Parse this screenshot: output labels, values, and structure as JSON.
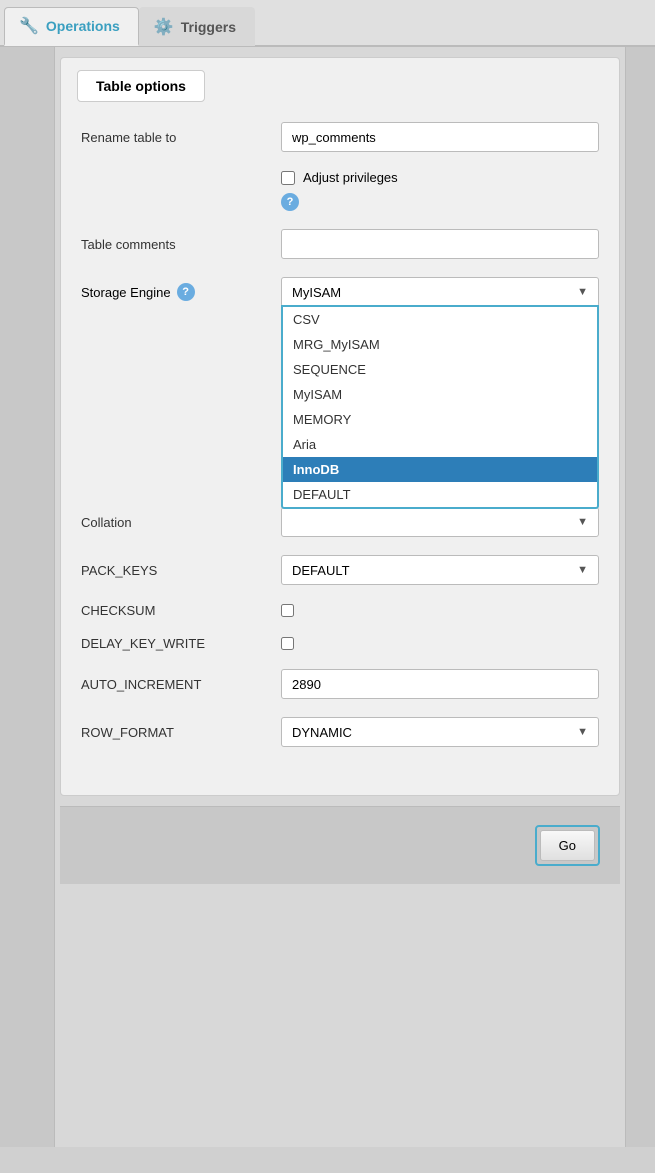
{
  "tabs": [
    {
      "id": "operations",
      "label": "Operations",
      "icon": "🔧",
      "active": true
    },
    {
      "id": "triggers",
      "label": "Triggers",
      "icon": "⚙️",
      "active": false
    }
  ],
  "card": {
    "header": "Table options",
    "fields": {
      "rename_label": "Rename table to",
      "rename_value": "wp_comments",
      "adjust_privileges_label": "Adjust privileges",
      "table_comments_label": "Table comments",
      "table_comments_value": "",
      "storage_engine_label": "Storage Engine",
      "storage_engine_value": "MyISAM",
      "collation_label": "Collation",
      "pack_keys_label": "PACK_KEYS",
      "pack_keys_value": "DEFAULT",
      "checksum_label": "CHECKSUM",
      "delay_key_write_label": "DELAY_KEY_WRITE",
      "auto_increment_label": "AUTO_INCREMENT",
      "auto_increment_value": "2890",
      "row_format_label": "ROW_FORMAT",
      "row_format_value": "DYNAMIC"
    },
    "storage_engine_options": [
      {
        "value": "CSV",
        "label": "CSV",
        "selected": false
      },
      {
        "value": "MRG_MyISAM",
        "label": "MRG_MyISAM",
        "selected": false
      },
      {
        "value": "SEQUENCE",
        "label": "SEQUENCE",
        "selected": false
      },
      {
        "value": "MyISAM",
        "label": "MyISAM",
        "selected": false
      },
      {
        "value": "MEMORY",
        "label": "MEMORY",
        "selected": false
      },
      {
        "value": "Aria",
        "label": "Aria",
        "selected": false
      },
      {
        "value": "InnoDB",
        "label": "InnoDB",
        "selected": true
      },
      {
        "value": "DEFAULT",
        "label": "DEFAULT",
        "selected": false
      }
    ]
  },
  "go_button_label": "Go"
}
